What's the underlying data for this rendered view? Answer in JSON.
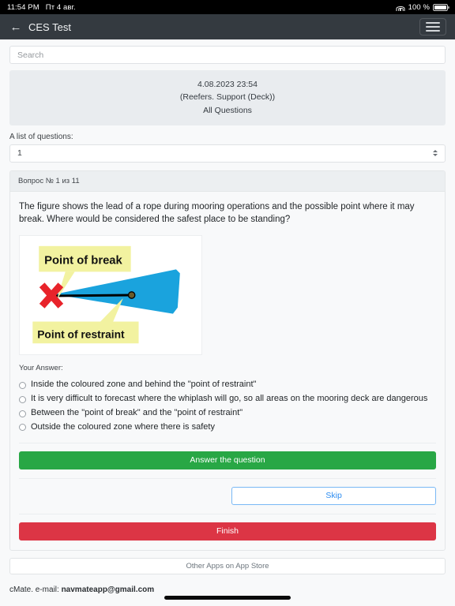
{
  "status_bar": {
    "time": "11:54 PM",
    "date": "Пт 4 авг.",
    "wifi_icon": "wifi-icon",
    "battery_percent": "100 %",
    "battery_icon": "battery-full-icon"
  },
  "header": {
    "back_icon": "←",
    "title": "CES Test",
    "menu_icon": "hamburger-menu-icon"
  },
  "search": {
    "value": "",
    "placeholder": "Search"
  },
  "info_panel": {
    "datetime": "4.08.2023 23:54",
    "category": "(Reefers. Support (Deck))",
    "scope": "All Questions"
  },
  "question_list": {
    "label": "A list of questions:",
    "selected": "1",
    "options": [
      "1"
    ]
  },
  "question_card": {
    "header": "Вопрос № 1 из 11",
    "text": "The figure shows the lead of a rope during mooring operations and the possible point where it may break. Where would be considered the safest place to be standing?",
    "figure": {
      "alt": "mooring-rope-snapback-zone-diagram",
      "callout_top": "Point of break",
      "callout_bottom": "Point of restraint",
      "colors": {
        "zone": "#1aa3dd",
        "callout": "#f2f2a0",
        "cross": "#e8232a"
      }
    },
    "answer_label": "Your Answer:",
    "options": [
      {
        "text": "Inside the coloured zone and behind the \"point of restraint\"",
        "selected": false
      },
      {
        "text": "It is very difficult to forecast where the whiplash will go, so all areas on the mooring deck are dangerous",
        "selected": false
      },
      {
        "text": "Between the \"point of break\" and the \"point of restraint\"",
        "selected": false
      },
      {
        "text": "Outside the coloured zone where there is safety",
        "selected": false
      }
    ],
    "buttons": {
      "answer": "Answer the question",
      "skip": "Skip",
      "finish": "Finish"
    }
  },
  "footer": {
    "store_button": "Other Apps on App Store",
    "copyright_prefix": "cMate. e-mail: ",
    "email": "navmateapp@gmail.com"
  },
  "colors": {
    "header_bg": "#343a40",
    "page_bg": "#f8f9fa",
    "success": "#28a745",
    "danger": "#dc3545",
    "link": "#2d8cf0"
  }
}
